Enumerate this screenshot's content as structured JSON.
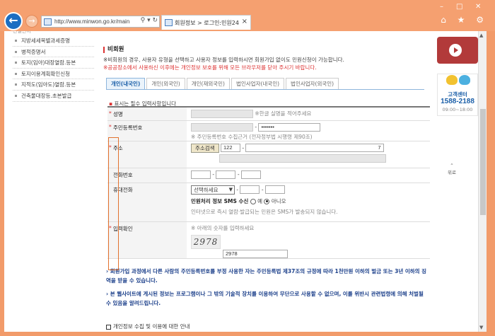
{
  "browser": {
    "window_controls": [
      "–",
      "□",
      "✕"
    ],
    "address": "http://www.minwon.go.kr/main",
    "address_buttons": "⚲ ▾ ↻",
    "tab_title": "회원정보 > 로그인:민원24",
    "tab_close": "×",
    "toolbar_icons": "⌂ ★ ⚙"
  },
  "leftmenu": {
    "top_partial": "건설면허",
    "items": [
      "지방세세목별과세증명",
      "병적증명서",
      "토지(임야)대장열람.등본",
      "토지이용계획확인신청",
      "지적도(임야도)열람.등본",
      "건축물대장등.초본발급"
    ]
  },
  "right": {
    "callcenter_label": "고객센터",
    "callcenter_number": "1588-2188",
    "callcenter_hours": "09:00~18:00",
    "to_top": "위로"
  },
  "main": {
    "section_title": "비회원",
    "info1": "※비회원의 경우, 사용자 유형을 선택하고 사용자 정보를 입력하시면 회원가입 없이도 민원신청이 가능합니다.",
    "info2": "※공공장소에서 사용하신 이후에는 개인정보 보호를 위해 모든 브라우저를 닫아 주시기 바랍니다.",
    "tabs": [
      "개인(내국인)",
      "개인(외국인)",
      "개인(재외국민)",
      "법인사업자(내국인)",
      "법인사업자(외국인)"
    ],
    "required_note": "표시는 필수 입력사항입니다"
  },
  "form": {
    "name_label": "성명",
    "name_hint": "※한글 실명을 적어주세요",
    "rrn_label": "주민등록번호",
    "rrn_masked": "•••••••",
    "rrn_note": "※ 주민등록번호 수집근거 (전자정부법 시행령 제90조)",
    "address_label": "주소",
    "address_button": "주소검색",
    "zip_first": "122",
    "address_tail": "7",
    "phone_label": "전화번호",
    "mobile_label": "휴대전화",
    "mobile_select": "선택하세요",
    "sms_label": "민원처리 정보 SMS 수신",
    "sms_yes": "예",
    "sms_no": "아니오",
    "sms_note": "인터넷으로 즉시 열람·발급되는 민원은 SMS가 발송되지 않습니다.",
    "captcha_label": "입력확인",
    "captcha_hint": "※ 아래의 숫자를 입력하세요",
    "captcha_image_text": "2978",
    "captcha_value": "2978"
  },
  "notices": [
    "회원가입 과정에서 다른 사람의 주민등록번호를 부정 사용한 자는 주민등록법 제37조의 규정에 따라 1천만원 이하의 벌금 또는 3년 이하의 징역을 받을 수 있습니다.",
    "본 웹사이트에 게시된 정보는 프로그램이나 그 밖의 기술적 장치를 이용하여 무단으로 사용할 수 없으며, 이를 위반시 관련법령에 의해 처벌될 수 있음을 알려드립니다."
  ],
  "privacy_link": "개인정보 수집 및 이용에 대한 안내"
}
